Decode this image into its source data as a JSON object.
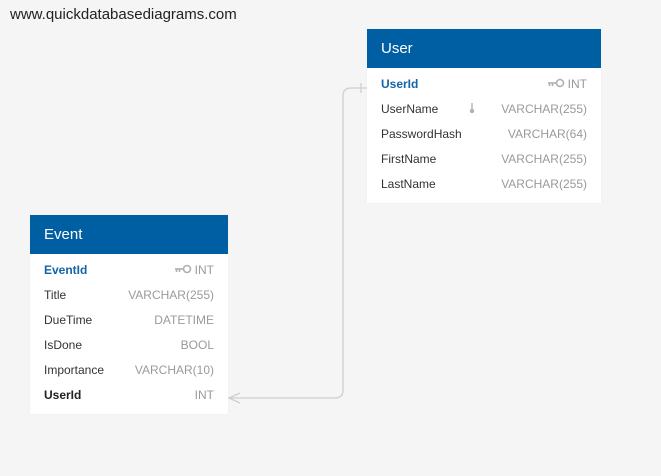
{
  "watermark": "www.quickdatabasediagrams.com",
  "tables": {
    "user": {
      "name": "User",
      "fields": [
        {
          "name": "UserId",
          "type": "INT",
          "pk": true
        },
        {
          "name": "UserName",
          "type": "VARCHAR(255)",
          "indexed": true
        },
        {
          "name": "PasswordHash",
          "type": "VARCHAR(64)"
        },
        {
          "name": "FirstName",
          "type": "VARCHAR(255)"
        },
        {
          "name": "LastName",
          "type": "VARCHAR(255)"
        }
      ]
    },
    "event": {
      "name": "Event",
      "fields": [
        {
          "name": "EventId",
          "type": "INT",
          "pk": true
        },
        {
          "name": "Title",
          "type": "VARCHAR(255)"
        },
        {
          "name": "DueTime",
          "type": "DATETIME"
        },
        {
          "name": "IsDone",
          "type": "BOOL"
        },
        {
          "name": "Importance",
          "type": "VARCHAR(10)"
        },
        {
          "name": "UserId",
          "type": "INT",
          "fk": true
        }
      ]
    }
  },
  "colors": {
    "header": "#005ea2",
    "pk_text": "#1464a8",
    "type_text": "#9a9a9a",
    "relation_line": "#cfcfcf"
  },
  "relationships": [
    {
      "from": "Event.UserId",
      "to": "User.UserId",
      "cardinality": "many-to-one"
    }
  ]
}
